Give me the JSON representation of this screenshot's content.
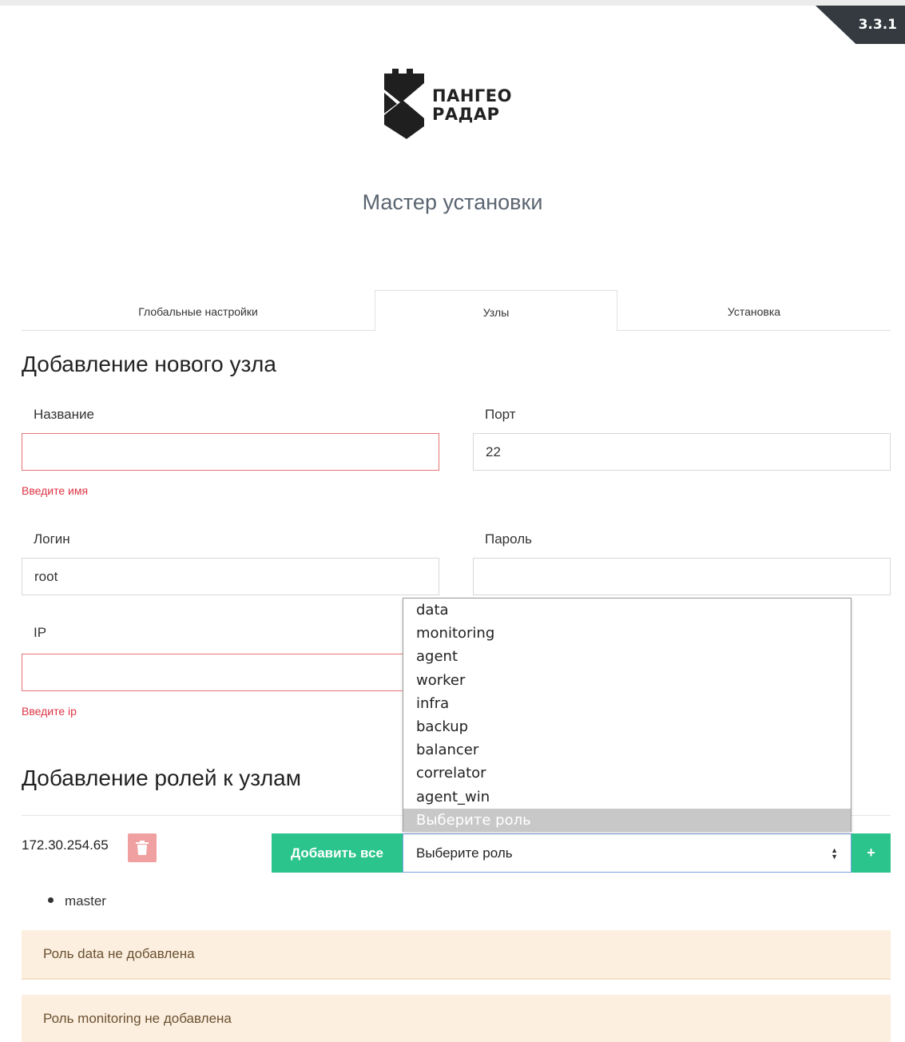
{
  "version": "3.3.1",
  "brand": {
    "line1": "ПАНГЕО",
    "line2": "РАДАР"
  },
  "wizard_title": "Мастер установки",
  "tabs": [
    {
      "label": "Глобальные настройки",
      "active": false
    },
    {
      "label": "Узлы",
      "active": true
    },
    {
      "label": "Установка",
      "active": false
    }
  ],
  "add_node": {
    "heading": "Добавление нового узла",
    "name": {
      "label": "Название",
      "value": "",
      "error": "Введите имя"
    },
    "port": {
      "label": "Порт",
      "value": "22"
    },
    "login": {
      "label": "Логин",
      "value": "root"
    },
    "password": {
      "label": "Пароль",
      "value": ""
    },
    "ip": {
      "label": "IP",
      "value": "",
      "error": "Введите ip"
    }
  },
  "add_roles": {
    "heading": "Добавление ролей к узлам",
    "node_ip": "172.30.254.65",
    "add_all_label": "Добавить все",
    "plus_label": "+",
    "select_value": "Выберите роль",
    "dropdown_options": [
      "data",
      "monitoring",
      "agent",
      "worker",
      "infra",
      "backup",
      "balancer",
      "correlator",
      "agent_win",
      "Выберите роль"
    ],
    "assigned_roles": [
      "master"
    ],
    "alerts": [
      "Роль data не добавлена",
      "Роль monitoring не добавлена"
    ]
  },
  "icons": {
    "trash": "trash-icon",
    "select_arrows": "sort-arrows-icon"
  },
  "colors": {
    "primary_green": "#2bc48c",
    "error_red": "#dc3545",
    "alert_bg": "#fcefdf",
    "version_bg": "#343a40"
  }
}
